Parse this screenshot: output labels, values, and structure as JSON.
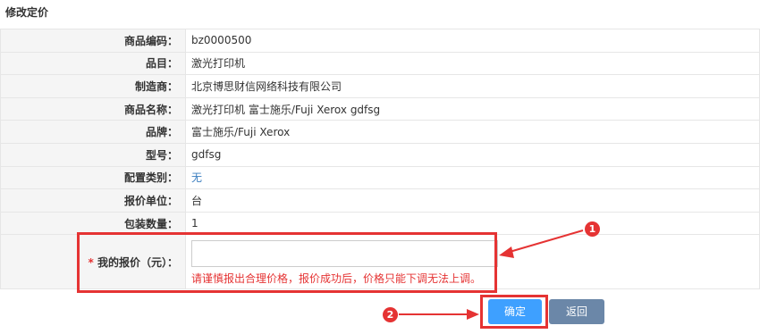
{
  "page_title": "修改定价",
  "fields": [
    {
      "label": "商品编码：",
      "value": "bz0000500"
    },
    {
      "label": "品目：",
      "value": "激光打印机"
    },
    {
      "label": "制造商：",
      "value": "北京博思财信网络科技有限公司"
    },
    {
      "label": "商品名称：",
      "value": "激光打印机 富士施乐/Fuji Xerox gdfsg"
    },
    {
      "label": "品牌：",
      "value": "富士施乐/Fuji Xerox"
    },
    {
      "label": "型号：",
      "value": "gdfsg"
    },
    {
      "label": "配置类别：",
      "value": "无"
    },
    {
      "label": "报价单位：",
      "value": "台"
    },
    {
      "label": "包装数量：",
      "value": "1"
    }
  ],
  "price": {
    "required_mark": "*",
    "label": " 我的报价（元）：",
    "value": "",
    "warning": "请谨慎报出合理价格，报价成功后，价格只能下调无法上调。"
  },
  "buttons": {
    "confirm": "确定",
    "back": "返回"
  },
  "annotations": {
    "badge1": "1",
    "badge2": "2"
  },
  "colors": {
    "highlight": "#e53333",
    "confirm_button": "#3ea0ff",
    "back_button": "#6b87a8",
    "link_value": "#3a7dbf"
  }
}
